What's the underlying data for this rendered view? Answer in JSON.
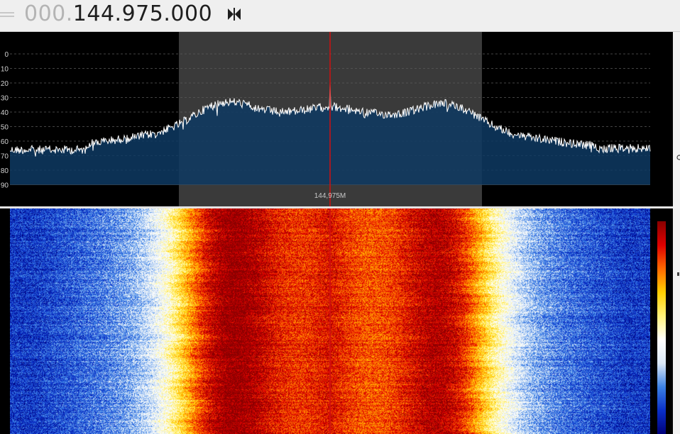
{
  "frequency_display": {
    "dim_digits": "000.",
    "main_digits": "144.975.000"
  },
  "toolbar": {
    "lock_icon": "tuning-lock-icon"
  },
  "spectrum": {
    "y_axis_labels": [
      "0",
      "10",
      "20",
      "30",
      "40",
      "50",
      "60",
      "70",
      "80",
      "90"
    ],
    "center_label": "144,975M",
    "grid": true,
    "colors": {
      "background": "#000000",
      "fill": "#0e3a63",
      "trace": "#ffffff",
      "passband": "#3a3a3a",
      "grid": "#5a5a5a",
      "center_marker": "#d01010"
    }
  },
  "waterfall": {
    "palette": [
      "#00007a",
      "#0a2fc8",
      "#3c82e6",
      "#dce9f7",
      "#ffffff",
      "#fff27a",
      "#ffd000",
      "#ff6a00",
      "#e00000",
      "#8a0000"
    ],
    "center_marker_color": "#d01010"
  }
}
